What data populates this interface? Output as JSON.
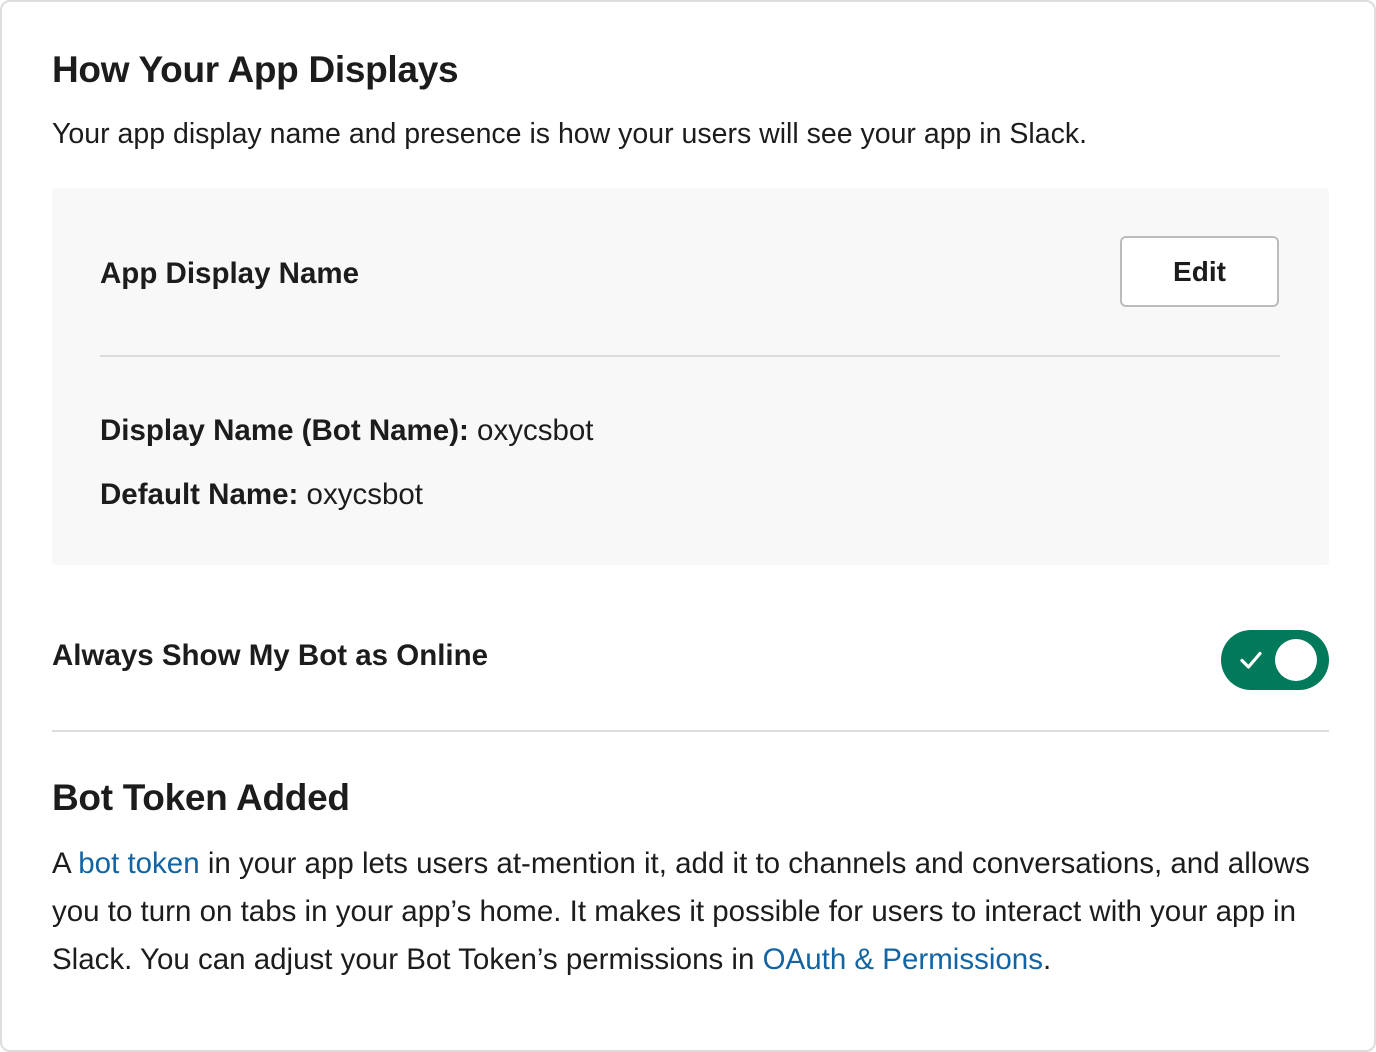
{
  "app_display_section": {
    "title": "How Your App Displays",
    "description": "Your app display name and presence is how your users will see your app in Slack.",
    "box": {
      "heading": "App Display Name",
      "edit_label": "Edit",
      "display_name_label": "Display Name (Bot Name):",
      "display_name_value": " oxycsbot",
      "default_name_label": "Default Name:",
      "default_name_value": " oxycsbot"
    }
  },
  "online_toggle": {
    "label": "Always Show My Bot as Online",
    "checked": true,
    "color": "#007a5a"
  },
  "bot_token_section": {
    "title": "Bot Token Added",
    "text_1": "A ",
    "link_1": "bot token",
    "text_2": " in your app lets users at-mention it, add it to channels and conversations, and allows you to turn on tabs in your app’s home. It makes it possible for users to interact with your app in Slack. You can adjust your Bot Token’s permissions in ",
    "link_2": "OAuth & Permissions",
    "text_3": "."
  },
  "colors": {
    "link": "#1264a3",
    "box_background": "#f8f8f8",
    "toggle_on": "#007a5a"
  },
  "icons": {
    "toggle_check": "check-icon"
  }
}
